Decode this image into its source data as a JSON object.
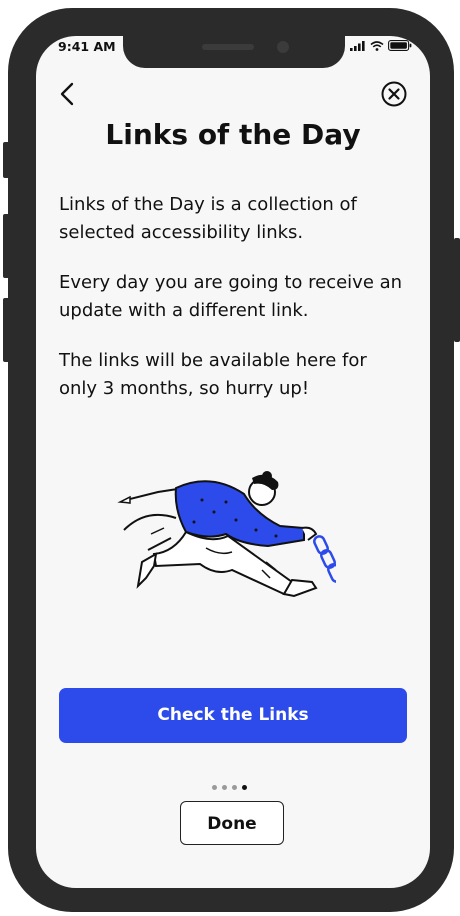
{
  "status_bar": {
    "time": "9:41 AM"
  },
  "header": {
    "back_icon": "chevron-left-icon",
    "close_icon": "close-circle-icon",
    "title": "Links of the Day"
  },
  "content": {
    "paragraphs": [
      "Links of the Day is a collection of selected accessibility links.",
      "Every day you are going to receive an update with a different link.",
      "The links will be available here for only 3 months, so hurry up!"
    ]
  },
  "cta": {
    "label": "Check the Links",
    "color": "#2c4bea"
  },
  "pager": {
    "total": 4,
    "active_index": 3
  },
  "done": {
    "label": "Done"
  }
}
